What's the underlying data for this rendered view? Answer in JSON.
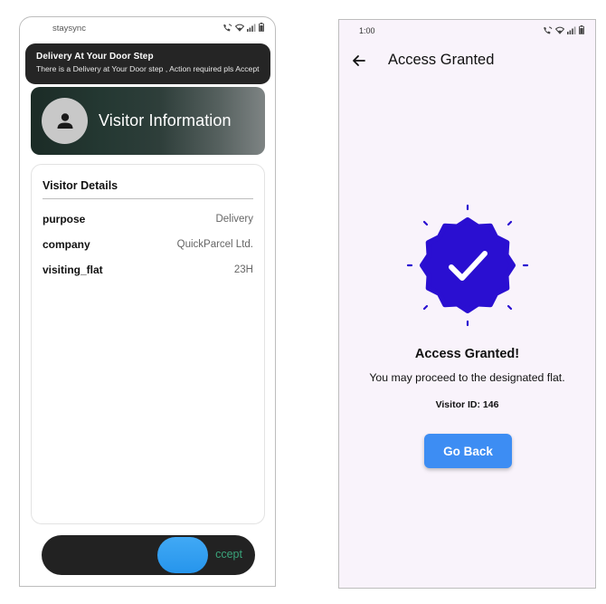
{
  "left_screen": {
    "status_bar": {
      "app_name": "staysync",
      "icons": [
        "call-wifi-icon",
        "wifi-icon",
        "signal-icon",
        "battery-icon"
      ]
    },
    "notification": {
      "title": "Delivery At Your Door Step",
      "body": "There is a Delivery at Your Door step , Action required pls Accept..."
    },
    "banner": {
      "avatar_icon": "person-icon",
      "title": "Visitor Information"
    },
    "details": {
      "title": "Visitor Details",
      "rows": [
        {
          "key": "purpose",
          "value": "Delivery"
        },
        {
          "key": "company",
          "value": "QuickParcel Ltd."
        },
        {
          "key": "visiting_flat",
          "value": "23H"
        }
      ]
    },
    "swipe": {
      "label": "ccept"
    }
  },
  "right_screen": {
    "status_bar": {
      "time": "1:00",
      "icons": [
        "call-wifi-icon",
        "wifi-icon",
        "signal-icon",
        "battery-icon"
      ]
    },
    "app_bar": {
      "back_icon": "arrow-left-icon",
      "title": "Access Granted"
    },
    "badge": {
      "icon": "verified-check-icon",
      "color": "#2a0fd1"
    },
    "heading": "Access Granted!",
    "message": "You may proceed to the designated flat.",
    "visitor_id": "Visitor ID: 146",
    "button_label": "Go Back"
  },
  "colors": {
    "accent_blue": "#3d8df3",
    "badge_indigo": "#2a0fd1",
    "swipe_green_text": "#3aa37a",
    "notification_bg": "#252525"
  }
}
